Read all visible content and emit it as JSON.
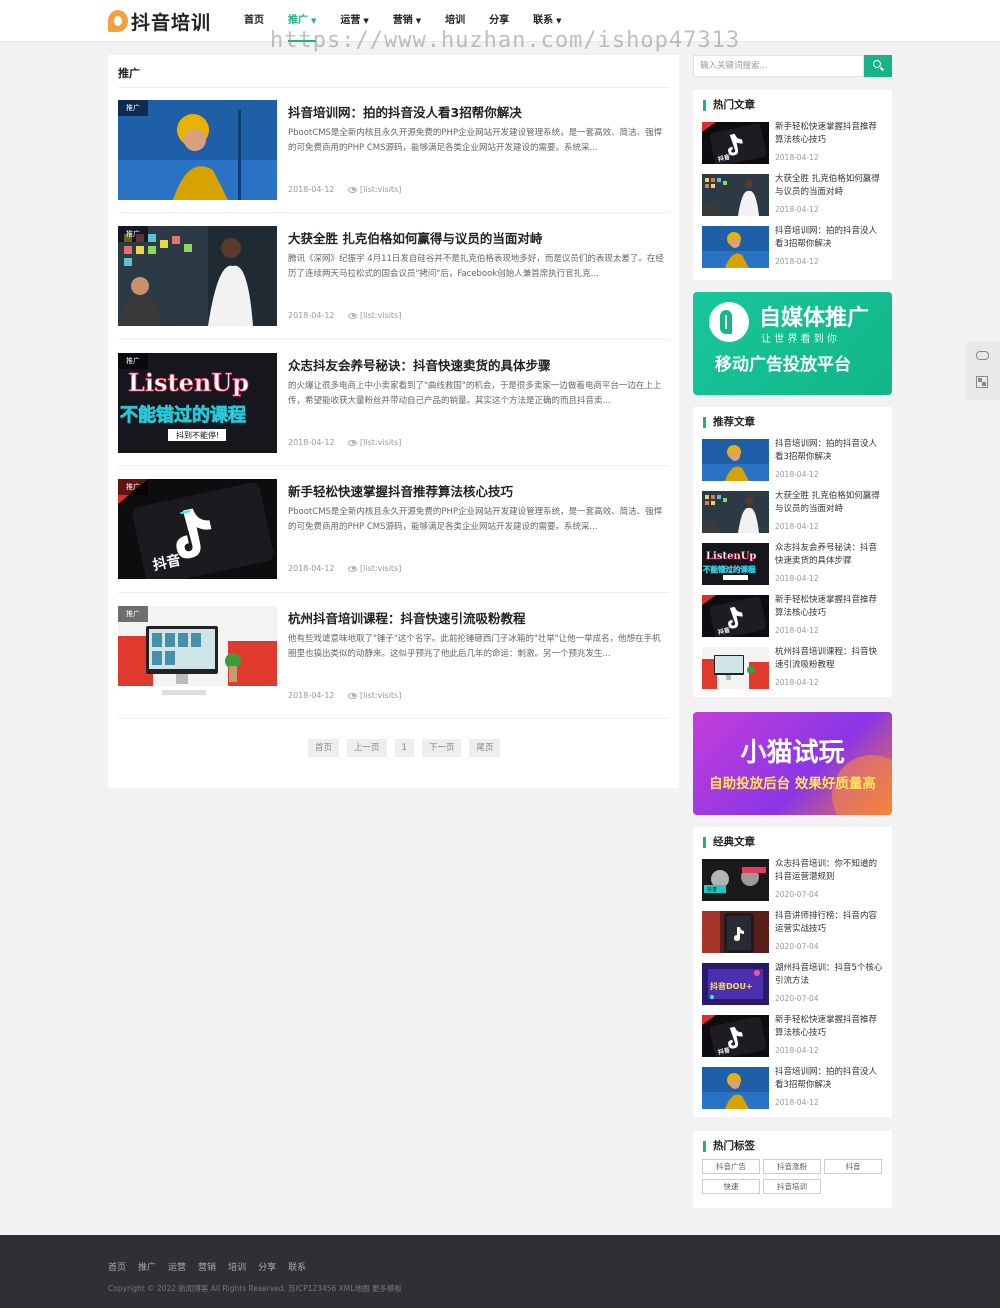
{
  "logo": {
    "text": "抖音培训"
  },
  "nav": [
    {
      "label": "首页"
    },
    {
      "label": "推广",
      "active": true,
      "has_caret": true
    },
    {
      "label": "运营",
      "has_caret": true
    },
    {
      "label": "营销",
      "has_caret": true
    },
    {
      "label": "培训"
    },
    {
      "label": "分享"
    },
    {
      "label": "联系",
      "has_caret": true
    }
  ],
  "watermark": "https://www.huzhan.com/ishop47313",
  "main": {
    "title": "推广",
    "articles": [
      {
        "tag": "推广",
        "title": "抖音培训网：拍的抖音没人看3招帮你解决",
        "desc": "PbootCMS是全新内核且永久开源免费的PHP企业网站开发建设管理系统，是一套高效、简洁、强悍的可免费商用的PHP CMS源码，能够满足各类企业网站开发建设的需要。系统采...",
        "date": "2018-04-12",
        "visits": "[list:visits]"
      },
      {
        "tag": "推广",
        "title": "大获全胜 扎克伯格如何赢得与议员的当面对峙",
        "desc": "腾讯《深网》纪振宇 4月11日发自硅谷并不是扎克伯格表现地多好，而是议员们的表现太差了。在经历了连续两天马拉松式的国会议员\"拷问\"后，Facebook创始人兼首席执行官扎克...",
        "date": "2018-04-12",
        "visits": "[list:visits]"
      },
      {
        "tag": "推广",
        "title": "众志抖友会养号秘诀：抖音快速卖货的具体步骤",
        "desc": "的火爆让很多电商上中小卖家看到了\"曲线救国\"的机会，于是很多卖家一边做着电商平台一边在上上传，希望能收获大量粉丝并带动自己产品的销量。其实这个方法是正确的而且抖音卖...",
        "date": "2018-04-12",
        "visits": "[list:visits]"
      },
      {
        "tag": "推广",
        "title": "新手轻松快速掌握抖音推荐算法核心技巧",
        "desc": "PbootCMS是全新内核且永久开源免费的PHP企业网站开发建设管理系统，是一套高效、简洁、强悍的可免费商用的PHP CMS源码，能够满足各类企业网站开发建设的需要。系统采...",
        "date": "2018-04-12",
        "visits": "[list:visits]"
      },
      {
        "tag": "推广",
        "title": "杭州抖音培训课程：抖音快速引流吸粉教程",
        "desc": "他有些戏谑意味地取了\"锤子\"这个名字。此前抡锤砸西门子冰箱的\"壮举\"让他一举成名，他想在手机圈里也搞出类似的动静来。这似乎预兆了他此后几年的命运：刺激。另一个预兆发生...",
        "date": "2018-04-12",
        "visits": "[list:visits]"
      }
    ],
    "pagination": [
      "首页",
      "上一页",
      "1",
      "下一页",
      "尾页"
    ]
  },
  "sidebar": {
    "search_placeholder": "输入关键词搜索...",
    "hot": {
      "title": "热门文章",
      "items": [
        {
          "title": "新手轻松快速掌握抖音推荐算法核心技巧",
          "date": "2018-04-12",
          "thumb": "tiktok"
        },
        {
          "title": "大获全胜 扎克伯格如何赢得与议员的当面对峙",
          "date": "2018-04-12",
          "thumb": "office"
        },
        {
          "title": "抖音培训网：拍的抖音没人看3招帮你解决",
          "date": "2018-04-12",
          "thumb": "woman"
        }
      ]
    },
    "banner1": {
      "line1": "自媒体推广",
      "line2": "让 世 界 看 到 你",
      "line3": "移动广告投放平台"
    },
    "recommend": {
      "title": "推荐文章",
      "items": [
        {
          "title": "抖音培训网：拍的抖音没人看3招帮你解决",
          "date": "2018-04-12",
          "thumb": "woman"
        },
        {
          "title": "大获全胜 扎克伯格如何赢得与议员的当面对峙",
          "date": "2018-04-12",
          "thumb": "office"
        },
        {
          "title": "众志抖友会养号秘诀：抖音快速卖货的具体步骤",
          "date": "2018-04-12",
          "thumb": "listen"
        },
        {
          "title": "新手轻松快速掌握抖音推荐算法核心技巧",
          "date": "2018-04-12",
          "thumb": "tiktok"
        },
        {
          "title": "杭州抖音培训课程：抖音快速引流吸粉教程",
          "date": "2018-04-12",
          "thumb": "desk"
        }
      ]
    },
    "banner2": {
      "line1": "小猫试玩",
      "line2": "自助投放后台 效果好质量高"
    },
    "classic": {
      "title": "经典文章",
      "items": [
        {
          "title": "众志抖音培训：你不知道的抖音运营潜规则",
          "date": "2020-07-04",
          "thumb": "dark1"
        },
        {
          "title": "抖音讲师排行榜：抖音内容运营实战技巧",
          "date": "2020-07-04",
          "thumb": "phone"
        },
        {
          "title": "湖州抖音培训：抖音5个核心引流方法",
          "date": "2020-07-04",
          "thumb": "purple"
        },
        {
          "title": "新手轻松快速掌握抖音推荐算法核心技巧",
          "date": "2018-04-12",
          "thumb": "tiktok"
        },
        {
          "title": "抖音培训网：拍的抖音没人看3招帮你解决",
          "date": "2018-04-12",
          "thumb": "woman"
        }
      ]
    },
    "tags": {
      "title": "热门标签",
      "items": [
        "抖音广告",
        "抖音涨粉",
        "抖音",
        "快速",
        "抖音培训"
      ]
    }
  },
  "footer": {
    "links": [
      "首页",
      "推广",
      "运营",
      "营销",
      "培训",
      "分享",
      "联系"
    ],
    "copyright": "Copyright © 2022 新闻博客 All Rights Reserved. 苏ICP123456 XML地图 更多模板"
  },
  "colors": {
    "accent": "#18b488",
    "footer_bg": "#2e3033",
    "banner1": "#18c49a",
    "banner2": "#b342d8"
  }
}
